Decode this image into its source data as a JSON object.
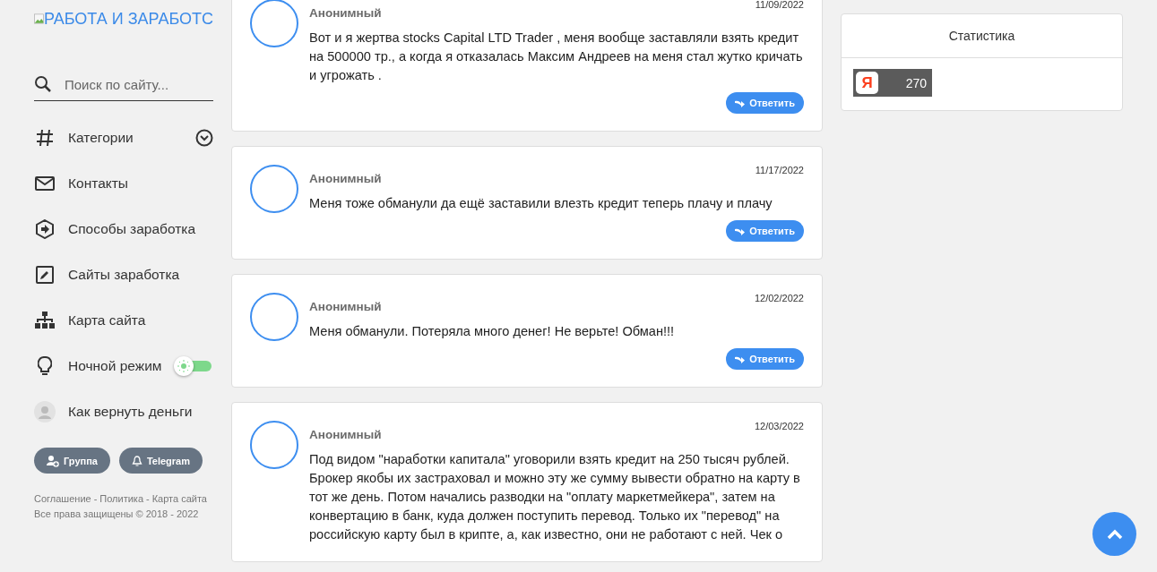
{
  "logo": {
    "alt_text": "РАБОТА И ЗАРАБОТС"
  },
  "search": {
    "placeholder": "Поиск по сайту..."
  },
  "menu": [
    {
      "kind": "hash",
      "label": "Категории",
      "expanded": false
    },
    {
      "kind": "mail",
      "label": "Контакты"
    },
    {
      "kind": "hexarrow",
      "label": "Способы заработка"
    },
    {
      "kind": "edit",
      "label": "Сайты заработка"
    },
    {
      "kind": "sitemap",
      "label": "Карта сайта"
    },
    {
      "kind": "bulb",
      "label": "Ночной режим",
      "on": true
    },
    {
      "kind": "avatar",
      "label": "Как вернуть деньги"
    }
  ],
  "social_buttons": [
    {
      "kind": "group",
      "label": "Группа"
    },
    {
      "kind": "telegram",
      "label": "Telegram"
    }
  ],
  "footer": {
    "items": [
      {
        "kind": "link",
        "text": "Соглашение"
      },
      {
        "kind": "sep",
        "text": "-"
      },
      {
        "kind": "link",
        "text": "Политика"
      },
      {
        "kind": "sep",
        "text": "-"
      },
      {
        "kind": "link",
        "text": "Карта сайта"
      }
    ],
    "copyright": "Все права защищены © 2018 - 2022"
  },
  "comments": [
    {
      "author": "Анонимный",
      "date": "11/09/2022",
      "text": "Вот и я жертва stocks Capital LTD Trader , меня вообще заставляли взять кредит на 500000 тр., а когда я отказалась Максим Андреев на меня стал жутко кричать и угрожать .",
      "reply": "Ответить"
    },
    {
      "author": "Анонимный",
      "date": "11/17/2022",
      "text": "Меня тоже обманули да ещё заставили влезть кредит теперь плачу и плачу",
      "reply": "Ответить"
    },
    {
      "author": "Анонимный",
      "date": "12/02/2022",
      "text": "Меня обманули. Потеряла много денег! Не верьте! Обман!!!",
      "reply": "Ответить"
    },
    {
      "author": "Анонимный",
      "date": "12/03/2022",
      "text": "Под видом \"наработки капитала\" уговорили взять кредит на 250 тысяч рублей. Брокер якобы их застраховал и можно эту же сумму вывести обратно на карту в тот же день. Потом начались разводки на \"оплату маркетмейкера\", затем на конвертацию в банк, куда должен поступить перевод. Только их \"перевод\" на российскую карту был в крипте, а, как известно, они не работают с ней. Чек о"
    }
  ],
  "stats": {
    "title": "Статистика",
    "counter": {
      "logo": "Я",
      "value": "270"
    }
  }
}
